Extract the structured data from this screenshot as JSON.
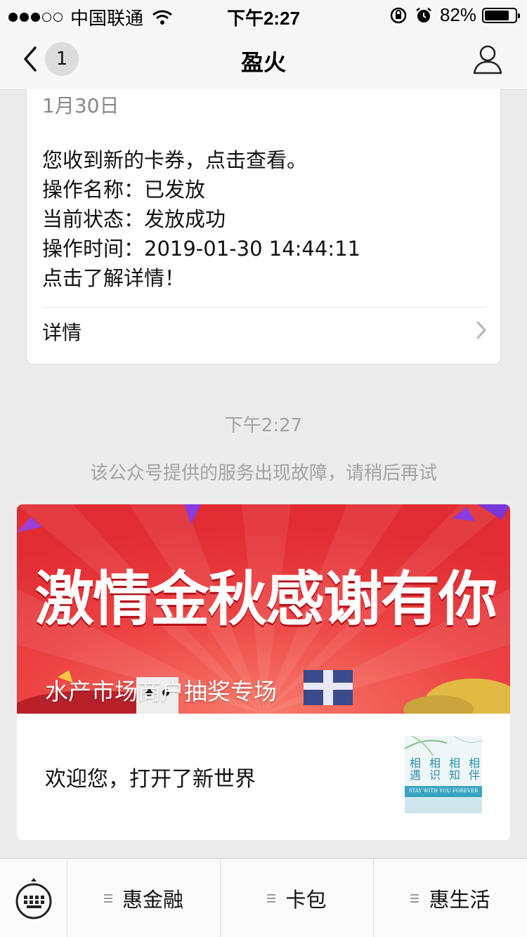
{
  "status_bar": {
    "carrier": "中国联通",
    "time": "下午2:27",
    "battery": "82%",
    "battery_level": 0.82
  },
  "nav": {
    "unread_count": "1",
    "title": "盈火"
  },
  "message_card": {
    "date": "1月30日",
    "lines": [
      "您收到新的卡券，点击查看。",
      "操作名称：已发放",
      "当前状态：发放成功",
      "操作时间：2019-01-30 14:44:11",
      "点击了解详情！"
    ],
    "detail_label": "详情"
  },
  "system": {
    "time": "下午2:27",
    "notice": "该公众号提供的服务出现故障，请稍后再试"
  },
  "article": {
    "banner_headline": "激情金秋感谢有你",
    "banner_title": "水产市场商户抽奖专场",
    "welcome": "欢迎您，打开了新世界",
    "thumb_chars": [
      "相遇",
      "相识",
      "相知",
      "相伴"
    ],
    "thumb_caption": "STAY WITH YOU FOREVER"
  },
  "bottom_menu": [
    {
      "label": "惠金融"
    },
    {
      "label": "卡包"
    },
    {
      "label": "惠生活"
    }
  ],
  "colors": {
    "banner_red": "#e83a3a",
    "background": "#ebebeb"
  }
}
